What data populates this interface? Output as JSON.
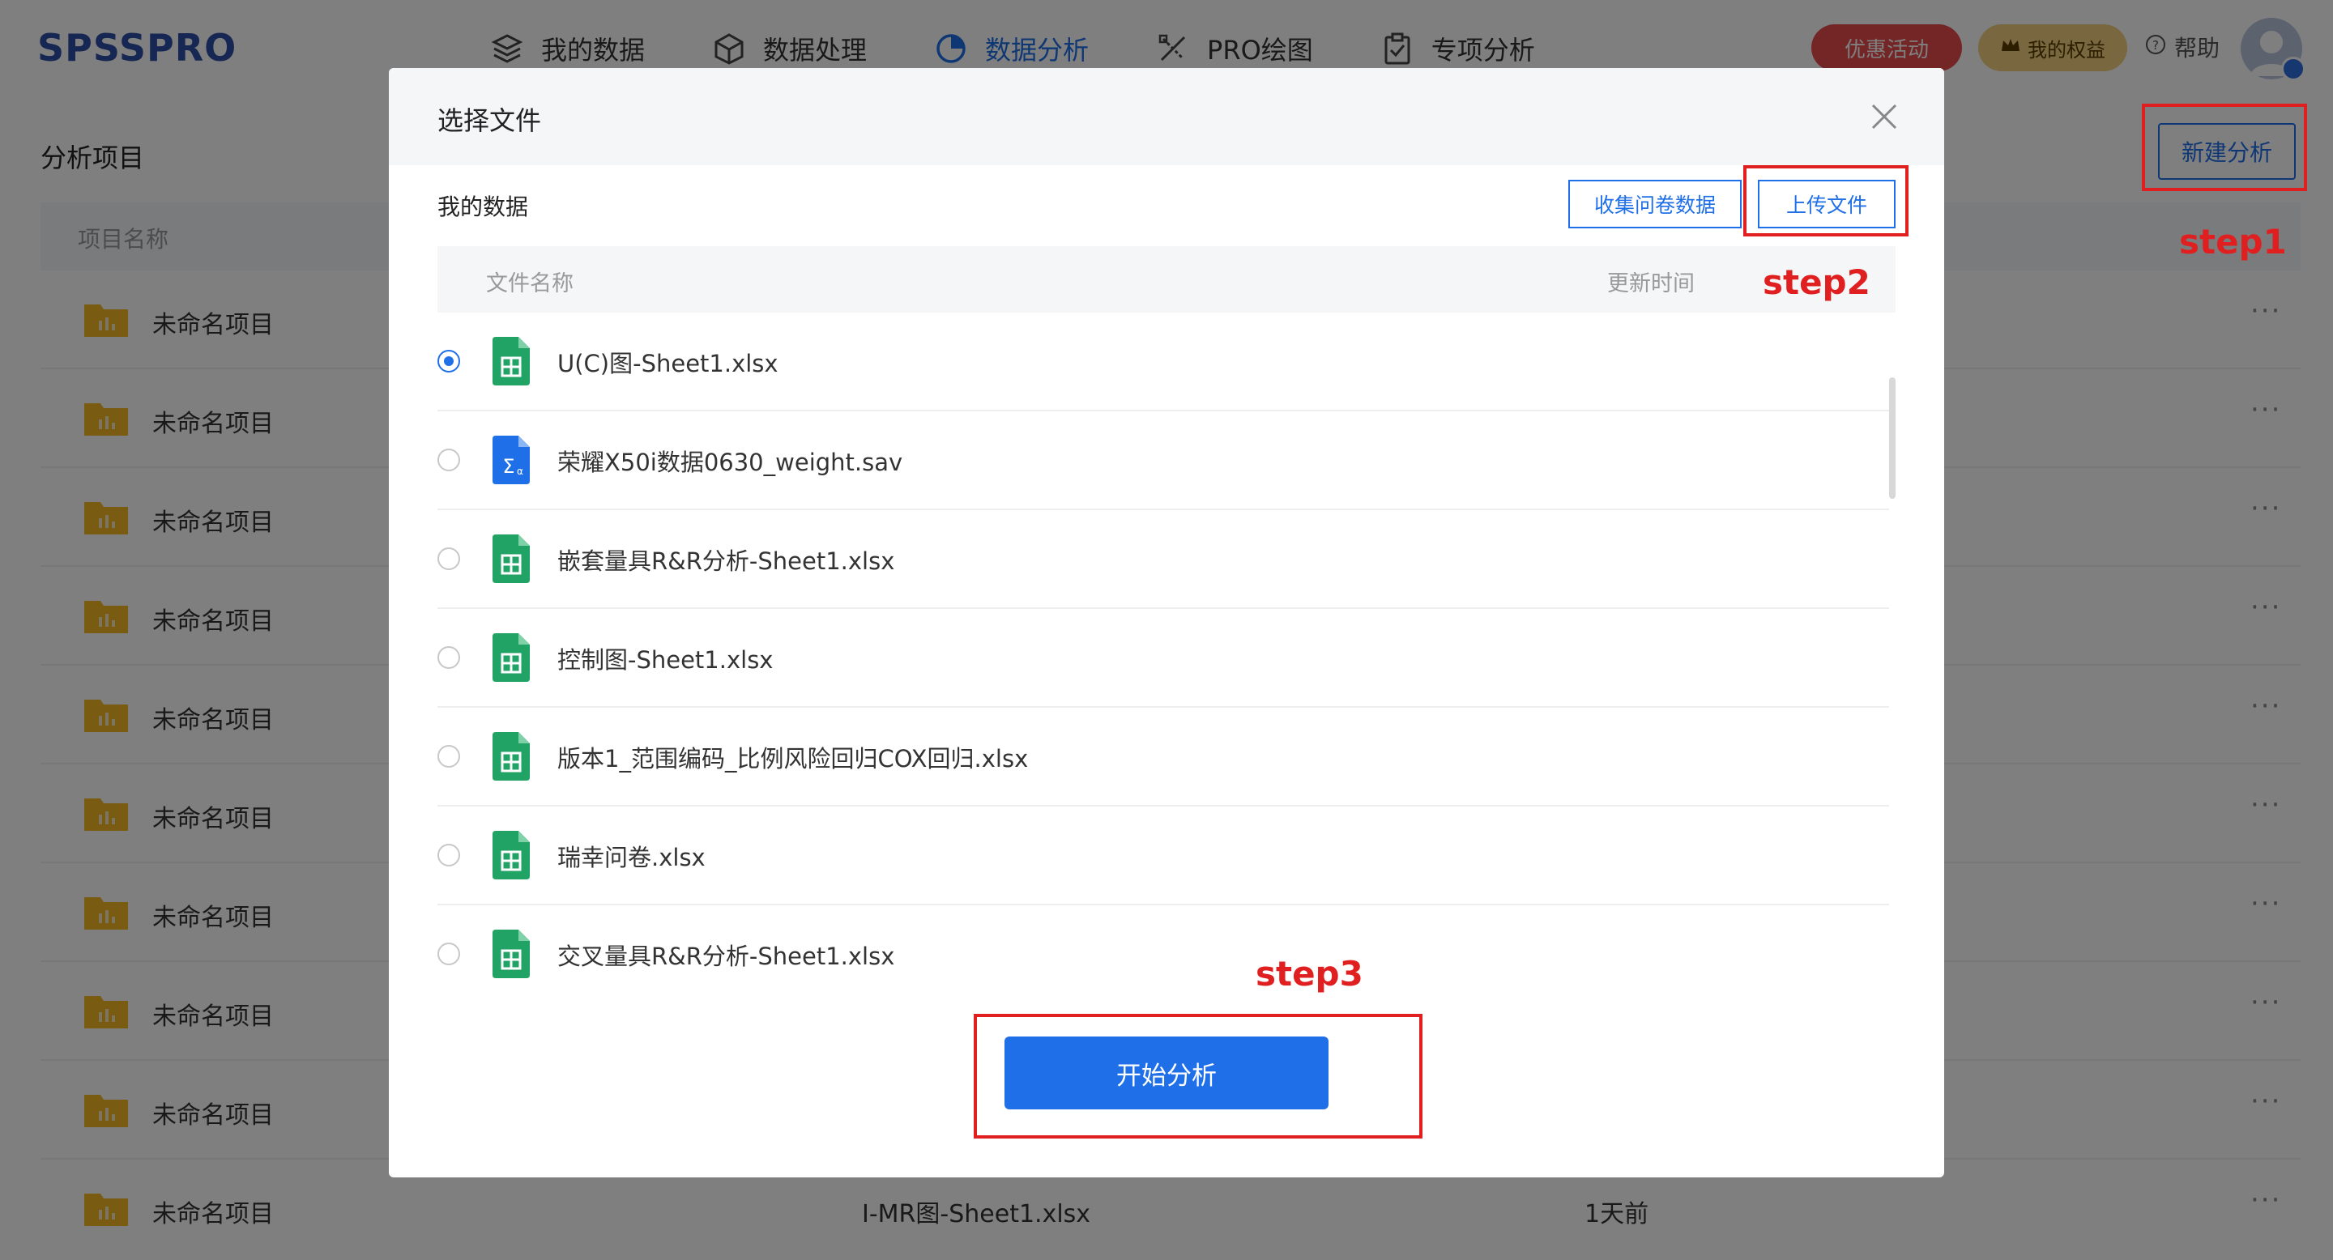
{
  "header": {
    "logo": "SPSSPRO",
    "nav": [
      {
        "label": "我的数据",
        "icon": "layers-icon",
        "active": false
      },
      {
        "label": "数据处理",
        "icon": "cube-icon",
        "active": false
      },
      {
        "label": "数据分析",
        "icon": "pie-chart-icon",
        "active": true
      },
      {
        "label": "PRO绘图",
        "icon": "pen-ruler-icon",
        "active": false
      },
      {
        "label": "专项分析",
        "icon": "clipboard-icon",
        "active": false
      }
    ],
    "promo_label": "优惠活动",
    "rights_label": "我的权益",
    "help_label": "帮助"
  },
  "page": {
    "section_title": "分析项目",
    "new_analysis_label": "新建分析",
    "column_header": "项目名称",
    "projects": [
      {
        "name": "未命名项目"
      },
      {
        "name": "未命名项目"
      },
      {
        "name": "未命名项目"
      },
      {
        "name": "未命名项目"
      },
      {
        "name": "未命名项目"
      },
      {
        "name": "未命名项目"
      },
      {
        "name": "未命名项目"
      },
      {
        "name": "未命名项目"
      },
      {
        "name": "未命名项目"
      },
      {
        "name": "未命名项目",
        "file": "I-MR图-Sheet1.xlsx",
        "time": "1天前"
      }
    ]
  },
  "modal": {
    "title": "选择文件",
    "subtitle": "我的数据",
    "collect_label": "收集问卷数据",
    "upload_label": "上传文件",
    "col_filename": "文件名称",
    "col_updated": "更新时间",
    "files": [
      {
        "name": "U(C)图-Sheet1.xlsx",
        "type": "xlsx",
        "selected": true
      },
      {
        "name": "荣耀X50i数据0630_weight.sav",
        "type": "sav",
        "selected": false
      },
      {
        "name": "嵌套量具R&R分析-Sheet1.xlsx",
        "type": "xlsx",
        "selected": false
      },
      {
        "name": "控制图-Sheet1.xlsx",
        "type": "xlsx",
        "selected": false
      },
      {
        "name": "版本1_范围编码_比例风险回归COX回归.xlsx",
        "type": "xlsx",
        "selected": false
      },
      {
        "name": "瑞幸问卷.xlsx",
        "type": "xlsx",
        "selected": false
      },
      {
        "name": "交叉量具R&R分析-Sheet1.xlsx",
        "type": "xlsx",
        "selected": false
      }
    ],
    "start_label": "开始分析"
  },
  "annotations": {
    "step1": "step1",
    "step2": "step2",
    "step3": "step3",
    "color": "#e02020"
  },
  "colors": {
    "accent": "#1f6fe8",
    "promo": "#e84a4a",
    "rights": "#f1cf7e",
    "folder": "#f2b924",
    "xlsx": "#21a366",
    "sav": "#1f6fe8"
  }
}
